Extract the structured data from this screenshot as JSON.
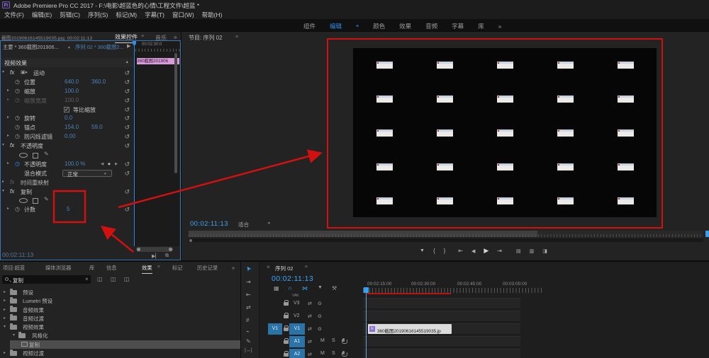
{
  "colors": {
    "accent_blue": "#2d8ceb",
    "value_blue": "#4d82b8",
    "timecode_blue": "#3da5f5",
    "annotation_red": "#d31010",
    "clip_pink": "#d79bd7",
    "track_blue": "#2c73a8"
  },
  "title_bar": {
    "app_icon": "Pr",
    "title": "Adobe Premiere Pro CC 2017 - F:\\电影\\超蓝色的心情\\工程文件\\超蓝 *"
  },
  "menu_bar": {
    "items": [
      "文件(F)",
      "编辑(E)",
      "剪辑(C)",
      "序列(S)",
      "标记(M)",
      "字幕(T)",
      "窗口(W)",
      "帮助(H)"
    ]
  },
  "workspace_bar": {
    "tabs": [
      "组件",
      "编辑",
      "颜色",
      "效果",
      "音频",
      "字幕",
      "库"
    ],
    "active": "编辑",
    "menu_icon": "≡",
    "overflow": "»"
  },
  "effect_controls": {
    "tab_source": "截图20190616145519035.jpg: 00:02:11:13",
    "tab_active": "效果控件",
    "tab_menu": "≡",
    "tab_next": "音乐",
    "overflow": "»",
    "master_clip": "主要 * 360截图201906...",
    "sequence_clip": "序列 02 * 360截图2...",
    "mini_ruler_time": "00:02:30:0",
    "mini_clip_label": "360截图201906",
    "section": "视频效果",
    "rows": [
      {
        "label": "运动"
      },
      {
        "label": "位置",
        "v1": "640.0",
        "v2": "360.0"
      },
      {
        "label": "缩放",
        "v1": "100.0"
      },
      {
        "label": "缩放宽度",
        "v1": "100.0"
      },
      {
        "label": "等比缩放"
      },
      {
        "label": "旋转",
        "v1": "0.0"
      },
      {
        "label": "锚点",
        "v1": "154.0",
        "v2": "59.0"
      },
      {
        "label": "防闪烁滤镜",
        "v1": "0.00"
      },
      {
        "label": "不透明度"
      },
      {
        "label": ""
      },
      {
        "label": "不透明度",
        "v1": "100.0 %"
      },
      {
        "label": "混合模式",
        "value": "正常"
      },
      {
        "label": "时间重映射"
      },
      {
        "label": "复制"
      },
      {
        "label": ""
      },
      {
        "label": "计数",
        "v1": "5"
      }
    ],
    "bottom_timecode": "00:02:11:13"
  },
  "monitor": {
    "tab": "节目: 序列 02",
    "tab_menu": "≡",
    "timecode": "00:02:11:13",
    "fit_label": "适合",
    "grid": {
      "rows": 5,
      "cols": 5
    },
    "transport": [
      "▼",
      "{",
      "}",
      "⇤",
      "◀",
      "▶",
      "⇥",
      "▤",
      "▥",
      "◨"
    ]
  },
  "project": {
    "tabs": [
      "项目:超蓝",
      "媒体浏览器",
      "库",
      "信息",
      "效果",
      "标记",
      "历史记录"
    ],
    "active": "效果",
    "tab_menu": "≡",
    "overflow": "»",
    "search_value": "复制",
    "search_clear": "×",
    "tree": [
      {
        "label": "预设",
        "depth": 0,
        "chev": "▸"
      },
      {
        "label": "Lumetri 预设",
        "depth": 0,
        "chev": "▸"
      },
      {
        "label": "音频效果",
        "depth": 0,
        "chev": "▸"
      },
      {
        "label": "音频过渡",
        "depth": 0,
        "chev": "▸"
      },
      {
        "label": "视频效果",
        "depth": 0,
        "chev": "▾"
      },
      {
        "label": "风格化",
        "depth": 1,
        "chev": "▾"
      },
      {
        "label": "复制",
        "depth": 2,
        "chev": "",
        "selected": true
      },
      {
        "label": "视频过渡",
        "depth": 0,
        "chev": "▸"
      }
    ]
  },
  "timeline": {
    "close": "×",
    "tab": "序列 02",
    "tab_menu": "≡",
    "timecode": "00:02:11:13",
    "ruler_labels": [
      "00:02:15:00",
      "00:02:30:00",
      "00:02:45:00",
      "00:03:00:00"
    ],
    "vak": "VAK",
    "video_tracks": [
      {
        "name": "V3"
      },
      {
        "name": "V2"
      },
      {
        "name": "V1",
        "source": "V1",
        "targeted": true
      }
    ],
    "audio_tracks": [
      {
        "name": "A1"
      },
      {
        "name": "A2"
      }
    ],
    "mute": "M",
    "solo": "S",
    "clip": {
      "badge": "fx",
      "label": "360截图20190616145519035.jp"
    }
  }
}
